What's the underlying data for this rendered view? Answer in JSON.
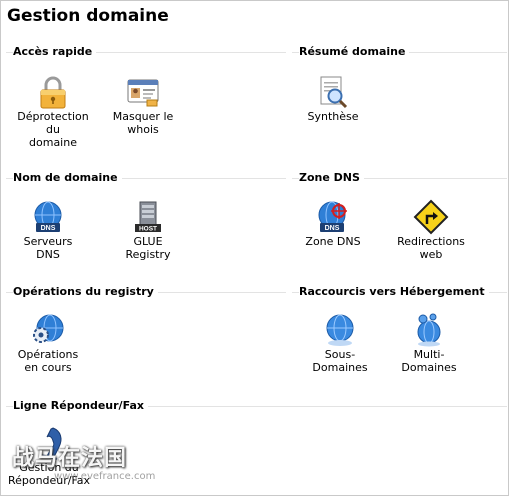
{
  "page_title": "Gestion domaine",
  "sections": {
    "acces_rapide": {
      "title": "Accès rapide",
      "items": [
        {
          "label_lines": [
            "Déprotection",
            "du",
            "domaine"
          ],
          "icon": "padlock-icon"
        },
        {
          "label_lines": [
            "Masquer le",
            "whois"
          ],
          "icon": "id-card-icon"
        }
      ]
    },
    "resume_domaine": {
      "title": "Résumé domaine",
      "items": [
        {
          "label_lines": [
            "Synthèse"
          ],
          "icon": "document-magnifier-icon"
        }
      ]
    },
    "nom_de_domaine": {
      "title": "Nom de domaine",
      "items": [
        {
          "label_lines": [
            "Serveurs",
            "DNS"
          ],
          "icon": "dns-globe-icon",
          "badge": "DNS"
        },
        {
          "label_lines": [
            "GLUE",
            "Registry"
          ],
          "icon": "host-server-icon",
          "badge": "HOST"
        }
      ]
    },
    "zone_dns": {
      "title": "Zone DNS",
      "items": [
        {
          "label_lines": [
            "Zone DNS"
          ],
          "icon": "dns-target-icon",
          "badge": "DNS"
        },
        {
          "label_lines": [
            "Redirections",
            "web"
          ],
          "icon": "redirect-sign-icon"
        }
      ]
    },
    "operations_registry": {
      "title": "Opérations du registry",
      "items": [
        {
          "label_lines": [
            "Opérations",
            "en cours"
          ],
          "icon": "globe-gear-icon"
        }
      ]
    },
    "raccourcis_hebergement": {
      "title": "Raccourcis vers Hébergement",
      "items": [
        {
          "label_lines": [
            "Sous-",
            "Domaines"
          ],
          "icon": "globe-subdomain-icon"
        },
        {
          "label_lines": [
            "Multi-",
            "Domaines"
          ],
          "icon": "globe-multi-icon"
        }
      ]
    },
    "ligne_repondeur": {
      "title": "Ligne Répondeur/Fax",
      "items": [
        {
          "label_lines": [
            "Gestion du",
            "Répondeur/Fax"
          ],
          "icon": "phone-icon"
        }
      ]
    }
  },
  "watermark": {
    "text": "战马在法国",
    "subtext": "www.evefrance.com"
  }
}
